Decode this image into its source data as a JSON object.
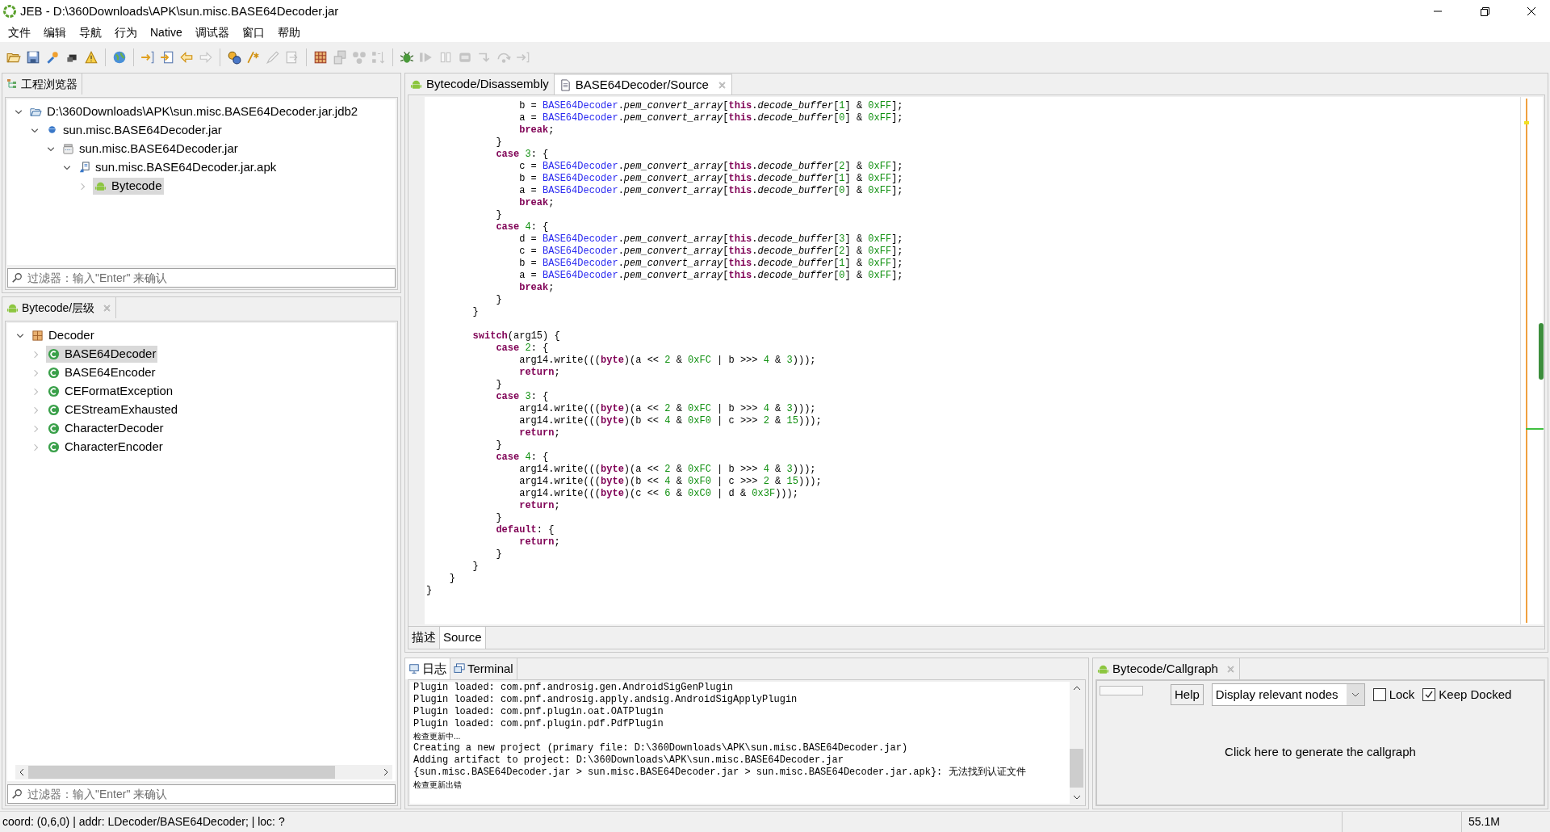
{
  "window": {
    "title": "JEB - D:\\360Downloads\\APK\\sun.misc.BASE64Decoder.jar"
  },
  "menu": [
    "文件",
    "编辑",
    "导航",
    "行为",
    "Native",
    "调试器",
    "窗口",
    "帮助"
  ],
  "toolbar": [
    [
      {
        "disabled": false
      },
      {
        "disabled": false
      },
      {
        "disabled": false
      },
      {
        "disabled": false
      },
      {
        "disabled": false
      }
    ],
    [
      {
        "disabled": false
      }
    ],
    [
      {
        "disabled": false
      },
      {
        "disabled": false
      },
      {
        "disabled": false
      },
      {
        "disabled": true
      }
    ],
    [
      {
        "disabled": false
      },
      {
        "disabled": false
      },
      {
        "disabled": true
      },
      {
        "disabled": true
      }
    ],
    [
      {
        "disabled": false
      },
      {
        "disabled": true
      },
      {
        "disabled": true
      },
      {
        "disabled": true
      }
    ],
    [
      {
        "disabled": false
      },
      {
        "disabled": true
      },
      {
        "disabled": true
      },
      {
        "disabled": true
      },
      {
        "disabled": true
      },
      {
        "disabled": true
      },
      {
        "disabled": true
      }
    ]
  ],
  "project_explorer": {
    "tab": "工程浏览器",
    "tree": [
      {
        "label": "D:\\360Downloads\\APK\\sun.misc.BASE64Decoder.jar.jdb2",
        "kind": "project",
        "expanded": true,
        "selected": false,
        "children": [
          {
            "label": "sun.misc.BASE64Decoder.jar",
            "kind": "artifact",
            "expanded": true,
            "selected": false,
            "children": [
              {
                "label": "sun.misc.BASE64Decoder.jar",
                "kind": "unit",
                "expanded": true,
                "selected": false,
                "children": [
                  {
                    "label": "sun.misc.BASE64Decoder.jar.apk",
                    "kind": "apk",
                    "expanded": true,
                    "selected": false,
                    "children": [
                      {
                        "label": "Bytecode",
                        "kind": "bytecode",
                        "expanded": false,
                        "selected": true
                      }
                    ]
                  }
                ]
              }
            ]
          }
        ]
      }
    ],
    "filter": {
      "placeholder": "过滤器：输入\"Enter\" 来确认"
    }
  },
  "hierarchy": {
    "tab": "Bytecode/层级",
    "closable": true,
    "tree": [
      {
        "label": "Decoder",
        "kind": "package",
        "expanded": true,
        "selected": false,
        "children": [
          {
            "label": "BASE64Decoder",
            "kind": "class",
            "expanded": false,
            "selected": true
          },
          {
            "label": "BASE64Encoder",
            "kind": "class",
            "expanded": false,
            "selected": false
          },
          {
            "label": "CEFormatException",
            "kind": "class",
            "expanded": false,
            "selected": false
          },
          {
            "label": "CEStreamExhausted",
            "kind": "class",
            "expanded": false,
            "selected": false
          },
          {
            "label": "CharacterDecoder",
            "kind": "class",
            "expanded": false,
            "selected": false
          },
          {
            "label": "CharacterEncoder",
            "kind": "class",
            "expanded": false,
            "selected": false
          }
        ]
      }
    ],
    "filter": {
      "placeholder": "过滤器：输入\"Enter\" 来确认"
    }
  },
  "editor": {
    "tabs": [
      {
        "label": "Bytecode/Disassembly",
        "kind": "bytecode",
        "selected": false,
        "closable": false
      },
      {
        "label": "BASE64Decoder/Source",
        "kind": "source",
        "selected": true,
        "closable": true
      }
    ],
    "code": [
      {
        "segments": [
          {
            "kind": "plain",
            "text": "                b = "
          },
          {
            "kind": "class",
            "text": "BASE64Decoder"
          },
          {
            "kind": "plain",
            "text": "."
          },
          {
            "kind": "field",
            "text": "pem_convert_array"
          },
          {
            "kind": "plain",
            "text": "["
          },
          {
            "kind": "keyword",
            "text": "this"
          },
          {
            "kind": "plain",
            "text": "."
          },
          {
            "kind": "field",
            "text": "decode_buffer"
          },
          {
            "kind": "plain",
            "text": "["
          },
          {
            "kind": "number",
            "text": "1"
          },
          {
            "kind": "plain",
            "text": "] & "
          },
          {
            "kind": "number",
            "text": "0xFF"
          },
          {
            "kind": "plain",
            "text": "];"
          }
        ]
      },
      {
        "segments": [
          {
            "kind": "plain",
            "text": "                a = "
          },
          {
            "kind": "class",
            "text": "BASE64Decoder"
          },
          {
            "kind": "plain",
            "text": "."
          },
          {
            "kind": "field",
            "text": "pem_convert_array"
          },
          {
            "kind": "plain",
            "text": "["
          },
          {
            "kind": "keyword",
            "text": "this"
          },
          {
            "kind": "plain",
            "text": "."
          },
          {
            "kind": "field",
            "text": "decode_buffer"
          },
          {
            "kind": "plain",
            "text": "["
          },
          {
            "kind": "number",
            "text": "0"
          },
          {
            "kind": "plain",
            "text": "] & "
          },
          {
            "kind": "number",
            "text": "0xFF"
          },
          {
            "kind": "plain",
            "text": "];"
          }
        ]
      },
      {
        "segments": [
          {
            "kind": "keyword",
            "text": "                break"
          },
          {
            "kind": "plain",
            "text": ";"
          }
        ]
      },
      {
        "segments": [
          {
            "kind": "plain",
            "text": "            }"
          }
        ]
      },
      {
        "segments": [
          {
            "kind": "keyword",
            "text": "            case "
          },
          {
            "kind": "number",
            "text": "3"
          },
          {
            "kind": "plain",
            "text": ": {"
          }
        ]
      },
      {
        "segments": [
          {
            "kind": "plain",
            "text": "                c = "
          },
          {
            "kind": "class",
            "text": "BASE64Decoder"
          },
          {
            "kind": "plain",
            "text": "."
          },
          {
            "kind": "field",
            "text": "pem_convert_array"
          },
          {
            "kind": "plain",
            "text": "["
          },
          {
            "kind": "keyword",
            "text": "this"
          },
          {
            "kind": "plain",
            "text": "."
          },
          {
            "kind": "field",
            "text": "decode_buffer"
          },
          {
            "kind": "plain",
            "text": "["
          },
          {
            "kind": "number",
            "text": "2"
          },
          {
            "kind": "plain",
            "text": "] & "
          },
          {
            "kind": "number",
            "text": "0xFF"
          },
          {
            "kind": "plain",
            "text": "];"
          }
        ]
      },
      {
        "segments": [
          {
            "kind": "plain",
            "text": "                b = "
          },
          {
            "kind": "class",
            "text": "BASE64Decoder"
          },
          {
            "kind": "plain",
            "text": "."
          },
          {
            "kind": "field",
            "text": "pem_convert_array"
          },
          {
            "kind": "plain",
            "text": "["
          },
          {
            "kind": "keyword",
            "text": "this"
          },
          {
            "kind": "plain",
            "text": "."
          },
          {
            "kind": "field",
            "text": "decode_buffer"
          },
          {
            "kind": "plain",
            "text": "["
          },
          {
            "kind": "number",
            "text": "1"
          },
          {
            "kind": "plain",
            "text": "] & "
          },
          {
            "kind": "number",
            "text": "0xFF"
          },
          {
            "kind": "plain",
            "text": "];"
          }
        ]
      },
      {
        "segments": [
          {
            "kind": "plain",
            "text": "                a = "
          },
          {
            "kind": "class",
            "text": "BASE64Decoder"
          },
          {
            "kind": "plain",
            "text": "."
          },
          {
            "kind": "field",
            "text": "pem_convert_array"
          },
          {
            "kind": "plain",
            "text": "["
          },
          {
            "kind": "keyword",
            "text": "this"
          },
          {
            "kind": "plain",
            "text": "."
          },
          {
            "kind": "field",
            "text": "decode_buffer"
          },
          {
            "kind": "plain",
            "text": "["
          },
          {
            "kind": "number",
            "text": "0"
          },
          {
            "kind": "plain",
            "text": "] & "
          },
          {
            "kind": "number",
            "text": "0xFF"
          },
          {
            "kind": "plain",
            "text": "];"
          }
        ]
      },
      {
        "segments": [
          {
            "kind": "keyword",
            "text": "                break"
          },
          {
            "kind": "plain",
            "text": ";"
          }
        ]
      },
      {
        "segments": [
          {
            "kind": "plain",
            "text": "            }"
          }
        ]
      },
      {
        "segments": [
          {
            "kind": "keyword",
            "text": "            case "
          },
          {
            "kind": "number",
            "text": "4"
          },
          {
            "kind": "plain",
            "text": ": {"
          }
        ]
      },
      {
        "segments": [
          {
            "kind": "plain",
            "text": "                d = "
          },
          {
            "kind": "class",
            "text": "BASE64Decoder"
          },
          {
            "kind": "plain",
            "text": "."
          },
          {
            "kind": "field",
            "text": "pem_convert_array"
          },
          {
            "kind": "plain",
            "text": "["
          },
          {
            "kind": "keyword",
            "text": "this"
          },
          {
            "kind": "plain",
            "text": "."
          },
          {
            "kind": "field",
            "text": "decode_buffer"
          },
          {
            "kind": "plain",
            "text": "["
          },
          {
            "kind": "number",
            "text": "3"
          },
          {
            "kind": "plain",
            "text": "] & "
          },
          {
            "kind": "number",
            "text": "0xFF"
          },
          {
            "kind": "plain",
            "text": "];"
          }
        ]
      },
      {
        "segments": [
          {
            "kind": "plain",
            "text": "                c = "
          },
          {
            "kind": "class",
            "text": "BASE64Decoder"
          },
          {
            "kind": "plain",
            "text": "."
          },
          {
            "kind": "field",
            "text": "pem_convert_array"
          },
          {
            "kind": "plain",
            "text": "["
          },
          {
            "kind": "keyword",
            "text": "this"
          },
          {
            "kind": "plain",
            "text": "."
          },
          {
            "kind": "field",
            "text": "decode_buffer"
          },
          {
            "kind": "plain",
            "text": "["
          },
          {
            "kind": "number",
            "text": "2"
          },
          {
            "kind": "plain",
            "text": "] & "
          },
          {
            "kind": "number",
            "text": "0xFF"
          },
          {
            "kind": "plain",
            "text": "];"
          }
        ]
      },
      {
        "segments": [
          {
            "kind": "plain",
            "text": "                b = "
          },
          {
            "kind": "class",
            "text": "BASE64Decoder"
          },
          {
            "kind": "plain",
            "text": "."
          },
          {
            "kind": "field",
            "text": "pem_convert_array"
          },
          {
            "kind": "plain",
            "text": "["
          },
          {
            "kind": "keyword",
            "text": "this"
          },
          {
            "kind": "plain",
            "text": "."
          },
          {
            "kind": "field",
            "text": "decode_buffer"
          },
          {
            "kind": "plain",
            "text": "["
          },
          {
            "kind": "number",
            "text": "1"
          },
          {
            "kind": "plain",
            "text": "] & "
          },
          {
            "kind": "number",
            "text": "0xFF"
          },
          {
            "kind": "plain",
            "text": "];"
          }
        ]
      },
      {
        "segments": [
          {
            "kind": "plain",
            "text": "                a = "
          },
          {
            "kind": "class",
            "text": "BASE64Decoder"
          },
          {
            "kind": "plain",
            "text": "."
          },
          {
            "kind": "field",
            "text": "pem_convert_array"
          },
          {
            "kind": "plain",
            "text": "["
          },
          {
            "kind": "keyword",
            "text": "this"
          },
          {
            "kind": "plain",
            "text": "."
          },
          {
            "kind": "field",
            "text": "decode_buffer"
          },
          {
            "kind": "plain",
            "text": "["
          },
          {
            "kind": "number",
            "text": "0"
          },
          {
            "kind": "plain",
            "text": "] & "
          },
          {
            "kind": "number",
            "text": "0xFF"
          },
          {
            "kind": "plain",
            "text": "];"
          }
        ]
      },
      {
        "segments": [
          {
            "kind": "keyword",
            "text": "                break"
          },
          {
            "kind": "plain",
            "text": ";"
          }
        ]
      },
      {
        "segments": [
          {
            "kind": "plain",
            "text": "            }"
          }
        ]
      },
      {
        "segments": [
          {
            "kind": "plain",
            "text": "        }"
          }
        ]
      },
      {
        "blank_before": true,
        "segments": [
          {
            "kind": "keyword",
            "text": "        switch"
          },
          {
            "kind": "plain",
            "text": "(arg15) {"
          }
        ]
      },
      {
        "segments": [
          {
            "kind": "keyword",
            "text": "            case "
          },
          {
            "kind": "number",
            "text": "2"
          },
          {
            "kind": "plain",
            "text": ": {"
          }
        ]
      },
      {
        "segments": [
          {
            "kind": "plain",
            "text": "                arg14.write((("
          },
          {
            "kind": "keyword",
            "text": "byte"
          },
          {
            "kind": "plain",
            "text": ")(a << "
          },
          {
            "kind": "number",
            "text": "2"
          },
          {
            "kind": "plain",
            "text": " & "
          },
          {
            "kind": "number",
            "text": "0xFC"
          },
          {
            "kind": "plain",
            "text": " | b >>> "
          },
          {
            "kind": "number",
            "text": "4"
          },
          {
            "kind": "plain",
            "text": " & "
          },
          {
            "kind": "number",
            "text": "3"
          },
          {
            "kind": "plain",
            "text": ")));"
          }
        ]
      },
      {
        "segments": [
          {
            "kind": "keyword",
            "text": "                return"
          },
          {
            "kind": "plain",
            "text": ";"
          }
        ]
      },
      {
        "segments": [
          {
            "kind": "plain",
            "text": "            }"
          }
        ]
      },
      {
        "segments": [
          {
            "kind": "keyword",
            "text": "            case "
          },
          {
            "kind": "number",
            "text": "3"
          },
          {
            "kind": "plain",
            "text": ": {"
          }
        ]
      },
      {
        "segments": [
          {
            "kind": "plain",
            "text": "                arg14.write((("
          },
          {
            "kind": "keyword",
            "text": "byte"
          },
          {
            "kind": "plain",
            "text": ")(a << "
          },
          {
            "kind": "number",
            "text": "2"
          },
          {
            "kind": "plain",
            "text": " & "
          },
          {
            "kind": "number",
            "text": "0xFC"
          },
          {
            "kind": "plain",
            "text": " | b >>> "
          },
          {
            "kind": "number",
            "text": "4"
          },
          {
            "kind": "plain",
            "text": " & "
          },
          {
            "kind": "number",
            "text": "3"
          },
          {
            "kind": "plain",
            "text": ")));"
          }
        ]
      },
      {
        "segments": [
          {
            "kind": "plain",
            "text": "                arg14.write((("
          },
          {
            "kind": "keyword",
            "text": "byte"
          },
          {
            "kind": "plain",
            "text": ")(b << "
          },
          {
            "kind": "number",
            "text": "4"
          },
          {
            "kind": "plain",
            "text": " & "
          },
          {
            "kind": "number",
            "text": "0xF0"
          },
          {
            "kind": "plain",
            "text": " | c >>> "
          },
          {
            "kind": "number",
            "text": "2"
          },
          {
            "kind": "plain",
            "text": " & "
          },
          {
            "kind": "number",
            "text": "15"
          },
          {
            "kind": "plain",
            "text": ")));"
          }
        ]
      },
      {
        "segments": [
          {
            "kind": "keyword",
            "text": "                return"
          },
          {
            "kind": "plain",
            "text": ";"
          }
        ]
      },
      {
        "segments": [
          {
            "kind": "plain",
            "text": "            }"
          }
        ]
      },
      {
        "segments": [
          {
            "kind": "keyword",
            "text": "            case "
          },
          {
            "kind": "number",
            "text": "4"
          },
          {
            "kind": "plain",
            "text": ": {"
          }
        ]
      },
      {
        "segments": [
          {
            "kind": "plain",
            "text": "                arg14.write((("
          },
          {
            "kind": "keyword",
            "text": "byte"
          },
          {
            "kind": "plain",
            "text": ")(a << "
          },
          {
            "kind": "number",
            "text": "2"
          },
          {
            "kind": "plain",
            "text": " & "
          },
          {
            "kind": "number",
            "text": "0xFC"
          },
          {
            "kind": "plain",
            "text": " | b >>> "
          },
          {
            "kind": "number",
            "text": "4"
          },
          {
            "kind": "plain",
            "text": " & "
          },
          {
            "kind": "number",
            "text": "3"
          },
          {
            "kind": "plain",
            "text": ")));"
          }
        ]
      },
      {
        "segments": [
          {
            "kind": "plain",
            "text": "                arg14.write((("
          },
          {
            "kind": "keyword",
            "text": "byte"
          },
          {
            "kind": "plain",
            "text": ")(b << "
          },
          {
            "kind": "number",
            "text": "4"
          },
          {
            "kind": "plain",
            "text": " & "
          },
          {
            "kind": "number",
            "text": "0xF0"
          },
          {
            "kind": "plain",
            "text": " | c >>> "
          },
          {
            "kind": "number",
            "text": "2"
          },
          {
            "kind": "plain",
            "text": " & "
          },
          {
            "kind": "number",
            "text": "15"
          },
          {
            "kind": "plain",
            "text": ")));"
          }
        ]
      },
      {
        "segments": [
          {
            "kind": "plain",
            "text": "                arg14.write((("
          },
          {
            "kind": "keyword",
            "text": "byte"
          },
          {
            "kind": "plain",
            "text": ")(c << "
          },
          {
            "kind": "number",
            "text": "6"
          },
          {
            "kind": "plain",
            "text": " & "
          },
          {
            "kind": "number",
            "text": "0xC0"
          },
          {
            "kind": "plain",
            "text": " | d & "
          },
          {
            "kind": "number",
            "text": "0x3F"
          },
          {
            "kind": "plain",
            "text": ")));"
          }
        ]
      },
      {
        "segments": [
          {
            "kind": "keyword",
            "text": "                return"
          },
          {
            "kind": "plain",
            "text": ";"
          }
        ]
      },
      {
        "segments": [
          {
            "kind": "plain",
            "text": "            }"
          }
        ]
      },
      {
        "segments": [
          {
            "kind": "keyword",
            "text": "            default"
          },
          {
            "kind": "plain",
            "text": ": {"
          }
        ]
      },
      {
        "segments": [
          {
            "kind": "keyword",
            "text": "                return"
          },
          {
            "kind": "plain",
            "text": ";"
          }
        ]
      },
      {
        "segments": [
          {
            "kind": "plain",
            "text": "            }"
          }
        ]
      },
      {
        "segments": [
          {
            "kind": "plain",
            "text": "        }"
          }
        ]
      },
      {
        "segments": [
          {
            "kind": "plain",
            "text": "    }"
          }
        ]
      },
      {
        "segments": [
          {
            "kind": "plain",
            "text": "}"
          }
        ]
      }
    ],
    "subtabs": [
      {
        "label": "描述",
        "selected": false
      },
      {
        "label": "Source",
        "selected": true
      }
    ]
  },
  "log": {
    "tabs": [
      {
        "label": "日志",
        "kind": "log",
        "selected": true
      },
      {
        "label": "Terminal",
        "kind": "terminal",
        "selected": false
      }
    ],
    "lines": [
      {
        "text": "Plugin loaded: com.pnf.androsig.gen.AndroidSigGenPlugin",
        "kind": "mono"
      },
      {
        "text": "Plugin loaded: com.pnf.androsig.apply.andsig.AndroidSigApplyPlugin",
        "kind": "mono"
      },
      {
        "text": "Plugin loaded: com.pnf.plugin.oat.OATPlugin",
        "kind": "mono"
      },
      {
        "text": "Plugin loaded: com.pnf.plugin.pdf.PdfPlugin",
        "kind": "mono"
      },
      {
        "text": "检查更新中...",
        "kind": "cjk"
      },
      {
        "text": "Creating a new project (primary file: D:\\360Downloads\\APK\\sun.misc.BASE64Decoder.jar)",
        "kind": "mono"
      },
      {
        "text": "Adding artifact to project: D:\\360Downloads\\APK\\sun.misc.BASE64Decoder.jar",
        "kind": "mono"
      },
      {
        "text": "{sun.misc.BASE64Decoder.jar > sun.misc.BASE64Decoder.jar > sun.misc.BASE64Decoder.jar.apk}: 无法找到认证文件",
        "kind": "mono"
      },
      {
        "text": "检查更新出错",
        "kind": "cjk"
      }
    ]
  },
  "callgraph": {
    "tab": "Bytecode/Callgraph",
    "closable": true,
    "help": "Help",
    "mode": "Display relevant nodes",
    "lock": {
      "label": "Lock",
      "checked": false
    },
    "keep_docked": {
      "label": "Keep Docked",
      "checked": true
    },
    "message": "Click here to generate the callgraph"
  },
  "status_bar": {
    "text": "coord: (0,6,0) | addr: LDecoder/BASE64Decoder; | loc: ?",
    "memory": "55.1M"
  }
}
